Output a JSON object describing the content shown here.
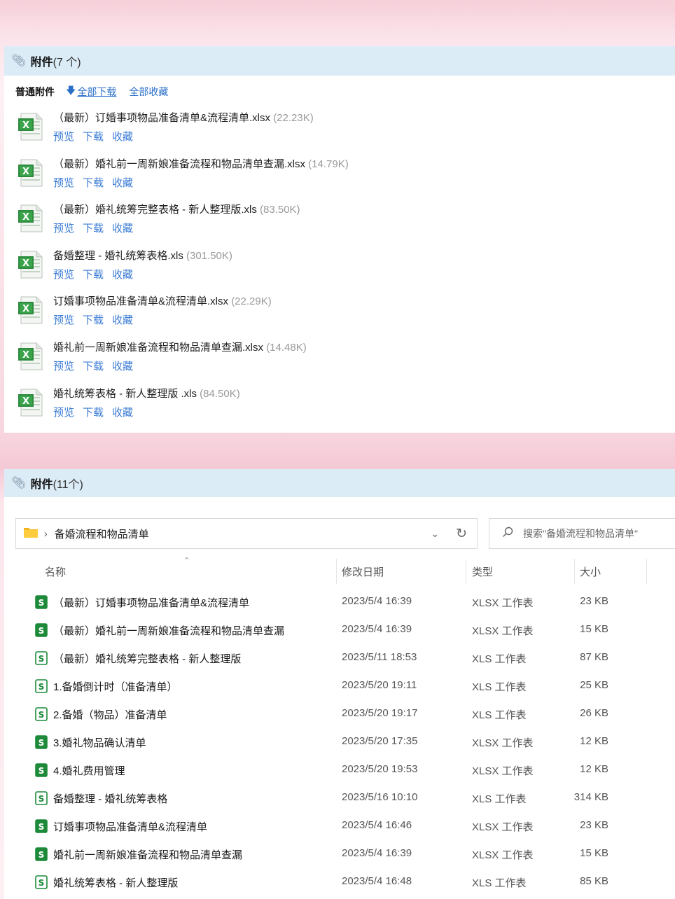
{
  "panel1": {
    "title": "附件",
    "count": "(7 个)",
    "section_label": "普通附件",
    "download_all": "全部下载",
    "collect_all": "全部收藏",
    "attachments": [
      {
        "name": "（最新）订婚事项物品准备清单&流程清单.xlsx",
        "size": "(22.23K)"
      },
      {
        "name": "（最新）婚礼前一周新娘准备流程和物品清单查漏.xlsx",
        "size": "(14.79K)"
      },
      {
        "name": "（最新）婚礼统筹完整表格 - 新人整理版.xls",
        "size": "(83.50K)"
      },
      {
        "name": "备婚整理 - 婚礼统筹表格.xls",
        "size": "(301.50K)"
      },
      {
        "name": "订婚事项物品准备清单&流程清单.xlsx",
        "size": "(22.29K)"
      },
      {
        "name": "婚礼前一周新娘准备流程和物品清单查漏.xlsx",
        "size": "(14.48K)"
      },
      {
        "name": "婚礼统筹表格 - 新人整理版 .xls",
        "size": "(84.50K)"
      }
    ],
    "actions": {
      "preview": "预览",
      "download": "下载",
      "collect": "收藏"
    }
  },
  "panel2": {
    "title": "附件",
    "count": "(11个)",
    "path": "备婚流程和物品清单",
    "search_placeholder": "搜索\"备婚流程和物品清单\"",
    "columns": {
      "name": "名称",
      "date": "修改日期",
      "type": "类型",
      "size": "大小"
    },
    "files": [
      {
        "name": "（最新）订婚事项物品准备清单&流程清单",
        "date": "2023/5/4 16:39",
        "type": "XLSX 工作表",
        "size": "23 KB"
      },
      {
        "name": "（最新）婚礼前一周新娘准备流程和物品清单查漏",
        "date": "2023/5/4 16:39",
        "type": "XLSX 工作表",
        "size": "15 KB"
      },
      {
        "name": "（最新）婚礼统筹完整表格 - 新人整理版",
        "date": "2023/5/11 18:53",
        "type": "XLS 工作表",
        "size": "87 KB"
      },
      {
        "name": "1.备婚倒计时（准备清单）",
        "date": "2023/5/20 19:11",
        "type": "XLS 工作表",
        "size": "25 KB"
      },
      {
        "name": "2.备婚（物品）准备清单",
        "date": "2023/5/20 19:17",
        "type": "XLS 工作表",
        "size": "26 KB"
      },
      {
        "name": "3.婚礼物品确认清单",
        "date": "2023/5/20 17:35",
        "type": "XLSX 工作表",
        "size": "12 KB"
      },
      {
        "name": "4.婚礼费用管理",
        "date": "2023/5/20 19:53",
        "type": "XLSX 工作表",
        "size": "12 KB"
      },
      {
        "name": "备婚整理 - 婚礼统筹表格",
        "date": "2023/5/16 10:10",
        "type": "XLS 工作表",
        "size": "314 KB"
      },
      {
        "name": "订婚事项物品准备清单&流程清单",
        "date": "2023/5/4 16:46",
        "type": "XLSX 工作表",
        "size": "23 KB"
      },
      {
        "name": "婚礼前一周新娘准备流程和物品清单查漏",
        "date": "2023/5/4 16:39",
        "type": "XLSX 工作表",
        "size": "15 KB"
      },
      {
        "name": "婚礼统筹表格 - 新人整理版",
        "date": "2023/5/4 16:48",
        "type": "XLS 工作表",
        "size": "85 KB"
      }
    ]
  },
  "colors": {
    "header_bg": "#dcecf7",
    "link_blue": "#3a7bd5",
    "excel_green": "#1d8a3a",
    "pink_bg": "#f6cfd9"
  }
}
